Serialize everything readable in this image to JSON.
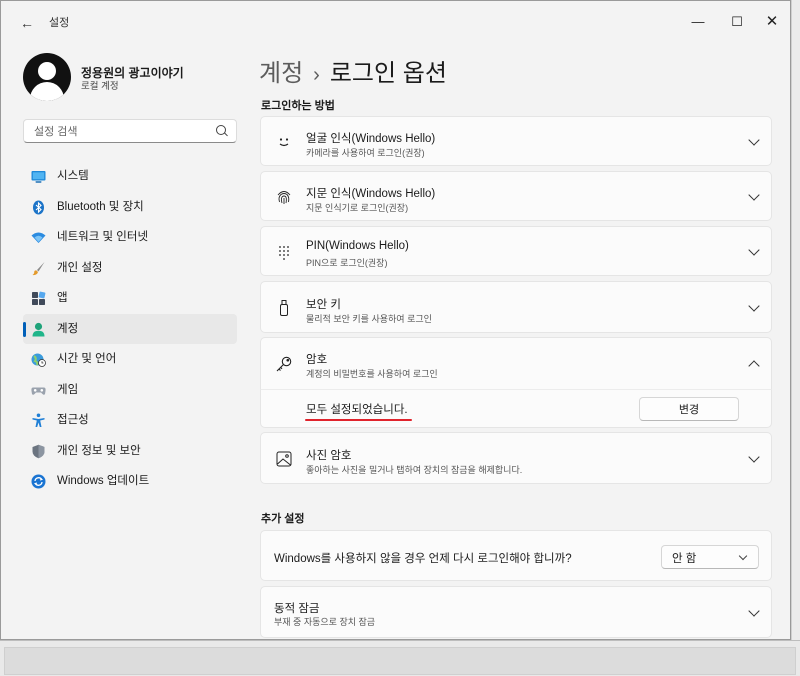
{
  "window": {
    "app_title": "설정",
    "back_symbol": "←",
    "controls": {
      "minimize": "—",
      "maximize": "☐",
      "close": "✕"
    }
  },
  "profile": {
    "name": "정용원의 광고이야기",
    "account_type": "로컬 계정"
  },
  "search": {
    "placeholder": "설정 검색",
    "icon": "search-icon"
  },
  "sidebar": {
    "items": [
      {
        "label": "시스템",
        "icon": "system-display-icon",
        "active": false
      },
      {
        "label": "Bluetooth 및 장치",
        "icon": "bluetooth-icon",
        "active": false
      },
      {
        "label": "네트워크 및 인터넷",
        "icon": "wifi-network-icon",
        "active": false
      },
      {
        "label": "개인 설정",
        "icon": "paintbrush-icon",
        "active": false
      },
      {
        "label": "앱",
        "icon": "apps-grid-icon",
        "active": false
      },
      {
        "label": "계정",
        "icon": "person-account-icon",
        "active": true
      },
      {
        "label": "시간 및 언어",
        "icon": "globe-clock-icon",
        "active": false
      },
      {
        "label": "게임",
        "icon": "gamepad-icon",
        "active": false
      },
      {
        "label": "접근성",
        "icon": "accessibility-icon",
        "active": false
      },
      {
        "label": "개인 정보 및 보안",
        "icon": "shield-icon",
        "active": false
      },
      {
        "label": "Windows 업데이트",
        "icon": "windows-update-icon",
        "active": false
      }
    ]
  },
  "header": {
    "breadcrumb_parent": "계정",
    "separator": "›",
    "current": "로그인 옵션"
  },
  "signin_section": {
    "heading": "로그인하는 방법",
    "options": [
      {
        "title": "얼굴 인식(Windows Hello)",
        "subtitle": "카메라를 사용하여 로그인(권장)",
        "icon": "face-smile-icon",
        "expanded": false
      },
      {
        "title": "지문 인식(Windows Hello)",
        "subtitle": "지문 인식기로 로그인(권장)",
        "icon": "fingerprint-icon",
        "expanded": false
      },
      {
        "title": "PIN(Windows Hello)",
        "subtitle": "PIN으로 로그인(권장)",
        "icon": "pin-keypad-icon",
        "expanded": false
      },
      {
        "title": "보안 키",
        "subtitle": "물리적 보안 키를 사용하여 로그인",
        "icon": "usb-key-icon",
        "expanded": false
      },
      {
        "title": "암호",
        "subtitle": "계정의 비밀번호를 사용하여 로그인",
        "icon": "key-icon",
        "expanded": true
      },
      {
        "title": "사진 암호",
        "subtitle": "좋아하는 사진을 밀거나 탭하여 장치의 잠금을 해제합니다.",
        "icon": "picture-icon",
        "expanded": false
      }
    ],
    "password_detail": {
      "status": "모두 설정되었습니다.",
      "change_button": "변경",
      "highlight_color": "#e0232c"
    }
  },
  "additional_section": {
    "heading": "추가 설정",
    "relogin_question": "Windows를 사용하지 않을 경우 언제 다시 로그인해야 합니까?",
    "relogin_value": "안 함",
    "dynamic_lock": {
      "title": "동적 잠금",
      "subtitle": "부재 중 자동으로 장치 잠금"
    }
  },
  "colors": {
    "accent": "#005fb8",
    "window_bg": "#f3f3f3",
    "card_bg": "#fbfbfb"
  }
}
